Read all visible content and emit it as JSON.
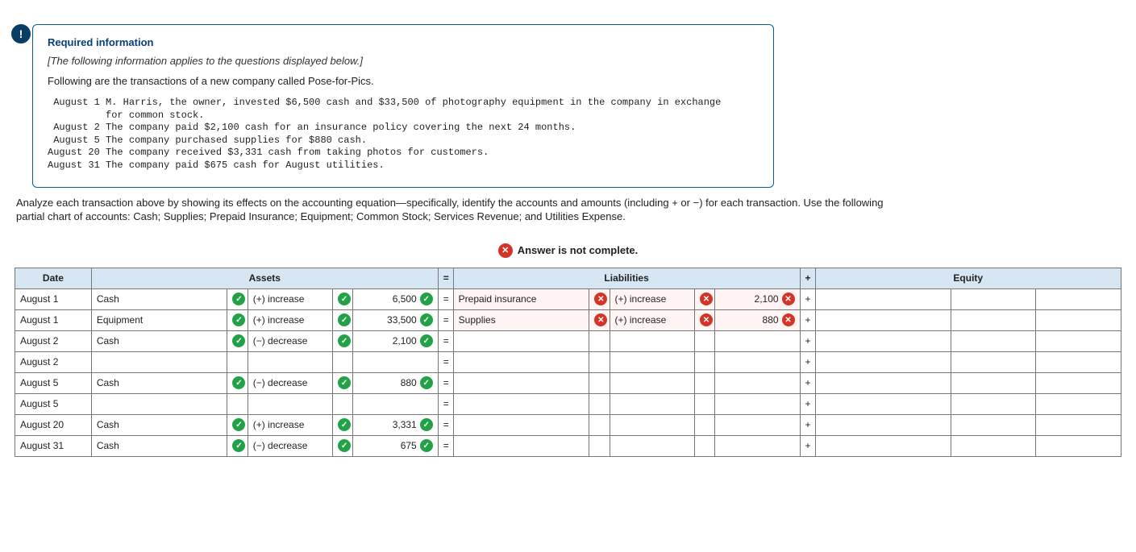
{
  "badge_char": "!",
  "info": {
    "heading": "Required information",
    "note": "[The following information applies to the questions displayed below.]",
    "intro": "Following are the transactions of a new company called Pose-for-Pics.",
    "pre": " August 1 M. Harris, the owner, invested $6,500 cash and $33,500 of photography equipment in the company in exchange\n          for common stock.\n August 2 The company paid $2,100 cash for an insurance policy covering the next 24 months.\n August 5 The company purchased supplies for $880 cash.\nAugust 20 The company received $3,331 cash from taking photos for customers.\nAugust 31 The company paid $675 cash for August utilities."
  },
  "instructions": "Analyze each transaction above by showing its effects on the accounting equation—specifically, identify the accounts and amounts (including + or −) for each transaction. Use the following partial chart of accounts: Cash; Supplies; Prepaid Insurance; Equipment; Common Stock; Services Revenue; and Utilities Expense.",
  "status": {
    "text": "Answer is not complete."
  },
  "headers": {
    "date": "Date",
    "assets": "Assets",
    "eq": "=",
    "liab": "Liabilities",
    "plus": "+",
    "equity": "Equity"
  },
  "rows": [
    {
      "date": "August 1",
      "a_acct": "Cash",
      "a_acct_ok": true,
      "a_dir": "(+) increase",
      "a_dir_ok": true,
      "a_amt": "6,500",
      "a_amt_ok": true,
      "l_acct": "Prepaid insurance",
      "l_acct_ok": false,
      "l_dir": "(+) increase",
      "l_dir_ok": false,
      "l_amt": "2,100",
      "l_amt_ok": false
    },
    {
      "date": "August 1",
      "a_acct": "Equipment",
      "a_acct_ok": true,
      "a_dir": "(+) increase",
      "a_dir_ok": true,
      "a_amt": "33,500",
      "a_amt_ok": true,
      "l_acct": "Supplies",
      "l_acct_ok": false,
      "l_dir": "(+) increase",
      "l_dir_ok": false,
      "l_amt": "880",
      "l_amt_ok": false
    },
    {
      "date": "August 2",
      "a_acct": "Cash",
      "a_acct_ok": true,
      "a_dir": "(−) decrease",
      "a_dir_ok": true,
      "a_amt": "2,100",
      "a_amt_ok": true
    },
    {
      "date": "August 2"
    },
    {
      "date": "August 5",
      "a_acct": "Cash",
      "a_acct_ok": true,
      "a_dir": "(−) decrease",
      "a_dir_ok": true,
      "a_amt": "880",
      "a_amt_ok": true
    },
    {
      "date": "August 5"
    },
    {
      "date": "August 20",
      "a_acct": "Cash",
      "a_acct_ok": true,
      "a_dir": "(+) increase",
      "a_dir_ok": true,
      "a_amt": "3,331",
      "a_amt_ok": true
    },
    {
      "date": "August 31",
      "a_acct": "Cash",
      "a_acct_ok": true,
      "a_dir": "(−) decrease",
      "a_dir_ok": true,
      "a_amt": "675",
      "a_amt_ok": true
    }
  ]
}
